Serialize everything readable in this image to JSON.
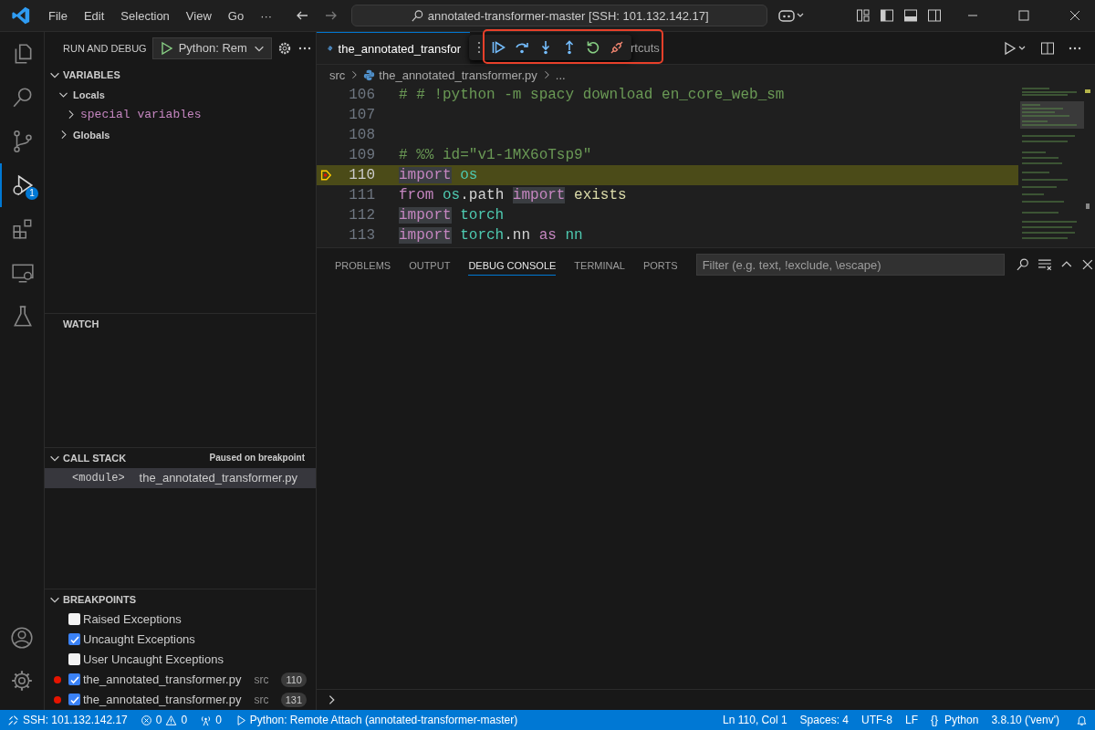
{
  "title_bar": {
    "menu": [
      "File",
      "Edit",
      "Selection",
      "View",
      "Go",
      "···"
    ],
    "command_center": "annotated-transformer-master [SSH: 101.132.142.17]"
  },
  "activity_bar": {
    "items": [
      {
        "selected": false
      },
      {
        "selected": false
      },
      {
        "selected": false
      },
      {
        "selected": true,
        "badge": "1"
      },
      {
        "selected": false
      },
      {
        "selected": false
      },
      {
        "selected": false
      }
    ]
  },
  "sidebar": {
    "title": "RUN AND DEBUG",
    "configuration": "Python: Rem",
    "variables": {
      "title": "VARIABLES",
      "expanded": true,
      "tree": [
        {
          "label": "Locals",
          "kind": "scope",
          "expanded": true,
          "children": [
            {
              "label": "special variables",
              "kind": "variable",
              "expanded": false
            }
          ]
        },
        {
          "label": "Globals",
          "kind": "scope",
          "expanded": false
        }
      ]
    },
    "watch": {
      "title": "WATCH"
    },
    "call_stack": {
      "title": "CALL STACK",
      "expanded": true,
      "status": "Paused on breakpoint",
      "frames": [
        {
          "name": "<module>",
          "file": "the_annotated_transformer.py",
          "selected": true
        }
      ]
    },
    "breakpoints": {
      "title": "BREAKPOINTS",
      "expanded": true,
      "items": [
        {
          "kind": "exception",
          "label": "Raised Exceptions",
          "checked": false
        },
        {
          "kind": "exception",
          "label": "Uncaught Exceptions",
          "checked": true
        },
        {
          "kind": "exception",
          "label": "User Uncaught Exceptions",
          "checked": false
        },
        {
          "kind": "file",
          "label": "the_annotated_transformer.py",
          "path": "src",
          "line": "110",
          "checked": true
        },
        {
          "kind": "file",
          "label": "the_annotated_transformer.py",
          "path": "src",
          "line": "131",
          "checked": true
        }
      ]
    }
  },
  "editor": {
    "tabs": [
      {
        "label": "the_annotated_transfor",
        "selected": true
      },
      {
        "label": "rtcuts",
        "selected": false
      }
    ],
    "breadcrumb": [
      "src",
      "the_annotated_transformer.py",
      "..."
    ],
    "lines": [
      {
        "number": "106",
        "current": false,
        "tokens": [
          {
            "kind": "comment",
            "text": "# # !python -m spacy download en_core_web_sm"
          }
        ]
      },
      {
        "number": "107",
        "current": false
      },
      {
        "number": "108",
        "current": false
      },
      {
        "number": "109",
        "current": false,
        "tokens": [
          {
            "kind": "comment",
            "text": "# %% id=\"v1-1MX6oTsp9\""
          }
        ]
      },
      {
        "number": "110",
        "current": true,
        "tokens": [
          {
            "kind": "keyword",
            "text": "import",
            "highlight": true
          },
          {
            "kind": "module",
            "text": " os"
          }
        ]
      },
      {
        "number": "111",
        "current": false,
        "tokens": [
          {
            "kind": "keyword",
            "text": "from"
          },
          {
            "kind": "module",
            "text": " os"
          },
          {
            "kind": "plain",
            "text": ".path "
          },
          {
            "kind": "keyword",
            "text": "import",
            "highlight": true
          },
          {
            "kind": "function",
            "text": " exists"
          }
        ]
      },
      {
        "number": "112",
        "current": false,
        "tokens": [
          {
            "kind": "keyword",
            "text": "import",
            "highlight": true
          },
          {
            "kind": "module",
            "text": " torch"
          }
        ]
      },
      {
        "number": "113",
        "current": false,
        "tokens": [
          {
            "kind": "keyword",
            "text": "import",
            "highlight": true
          },
          {
            "kind": "module",
            "text": " torch"
          },
          {
            "kind": "plain",
            "text": ".nn "
          },
          {
            "kind": "keyword",
            "text": "as"
          },
          {
            "kind": "module",
            "text": " nn"
          }
        ]
      }
    ]
  },
  "panel": {
    "tabs": [
      {
        "label": "PROBLEMS",
        "selected": false
      },
      {
        "label": "OUTPUT",
        "selected": false
      },
      {
        "label": "DEBUG CONSOLE",
        "selected": true
      },
      {
        "label": "TERMINAL",
        "selected": false
      },
      {
        "label": "PORTS",
        "selected": false
      }
    ],
    "filter": {
      "placeholder": "Filter (e.g. text, !exclude, \\escape)"
    }
  },
  "status_bar": {
    "remote": "SSH: 101.132.142.17",
    "errors": "0",
    "warnings": "0",
    "ports": "0",
    "debug": "Python: Remote Attach (annotated-transformer-master)",
    "right": [
      "Ln 110, Col 1",
      "Spaces: 4",
      "UTF-8",
      "LF"
    ],
    "language_icon": "{}",
    "language": "Python",
    "interpreter": "3.8.10 ('venv')"
  }
}
